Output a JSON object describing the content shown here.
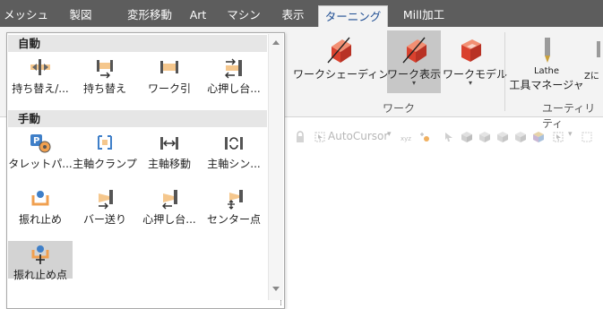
{
  "tabs": [
    {
      "label": "メッシュ",
      "active": false
    },
    {
      "label": "製図",
      "active": false
    },
    {
      "label": "変形移動",
      "active": false
    },
    {
      "label": "Art",
      "active": false
    },
    {
      "label": "マシン",
      "active": false
    },
    {
      "label": "表示",
      "active": false
    },
    {
      "label": "ターニング",
      "active": true
    },
    {
      "label": "Mill加工",
      "active": false
    }
  ],
  "ribbon": {
    "buttons": {
      "work_shading": {
        "label": "ワークシェーディング",
        "icon": "work-shading-icon"
      },
      "work_display": {
        "label": "ワーク表示",
        "dropdown": "▾",
        "icon": "work-display-icon"
      },
      "work_model": {
        "label": "ワークモデル",
        "dropdown": "▾",
        "icon": "work-model-icon"
      },
      "lathe_tool_manager": {
        "line1": "Lathe",
        "line2": "工具マネージャ",
        "icon": "lathe-tool-icon"
      },
      "cut_partial": {
        "label": "Zに"
      }
    },
    "groups": {
      "work": "ワーク",
      "utility": "ユーティリティ"
    }
  },
  "toolbar2": {
    "autocursor": "AutoCursor",
    "dropdown": "▾"
  },
  "popup": {
    "sections": {
      "auto": "自動",
      "manual": "手動"
    },
    "auto_items": [
      {
        "label": "持ち替え/...",
        "icon": "swap-stock-icon"
      },
      {
        "label": "持ち替え",
        "icon": "transfer-icon"
      },
      {
        "label": "ワーク引",
        "icon": "stock-pull-icon"
      },
      {
        "label": "心押し台...",
        "icon": "tailstock-icon"
      }
    ],
    "manual_items": [
      {
        "label": "タレットパ...",
        "icon": "turret-icon"
      },
      {
        "label": "主軸クランプ",
        "icon": "spindle-clamp-icon"
      },
      {
        "label": "主軸移動",
        "icon": "spindle-move-icon"
      },
      {
        "label": "主軸シン...",
        "icon": "spindle-sync-icon"
      },
      {
        "label": "振れ止め",
        "icon": "steady-rest-icon"
      },
      {
        "label": "バー送り",
        "icon": "bar-feed-icon"
      },
      {
        "label": "心押し台...",
        "icon": "tailstock-manual-icon"
      },
      {
        "label": "センター点",
        "icon": "center-point-icon"
      },
      {
        "label": "振れ止め点",
        "icon": "steady-rest-point-icon",
        "selected": true
      }
    ]
  },
  "colors": {
    "tabbar": "#5d5d5d",
    "ribbon": "#f3f3f3",
    "active_tab_text": "#1f4e93",
    "orange": "#ef8a3a",
    "blue": "#3f7fc8",
    "red": "#d9412e"
  }
}
